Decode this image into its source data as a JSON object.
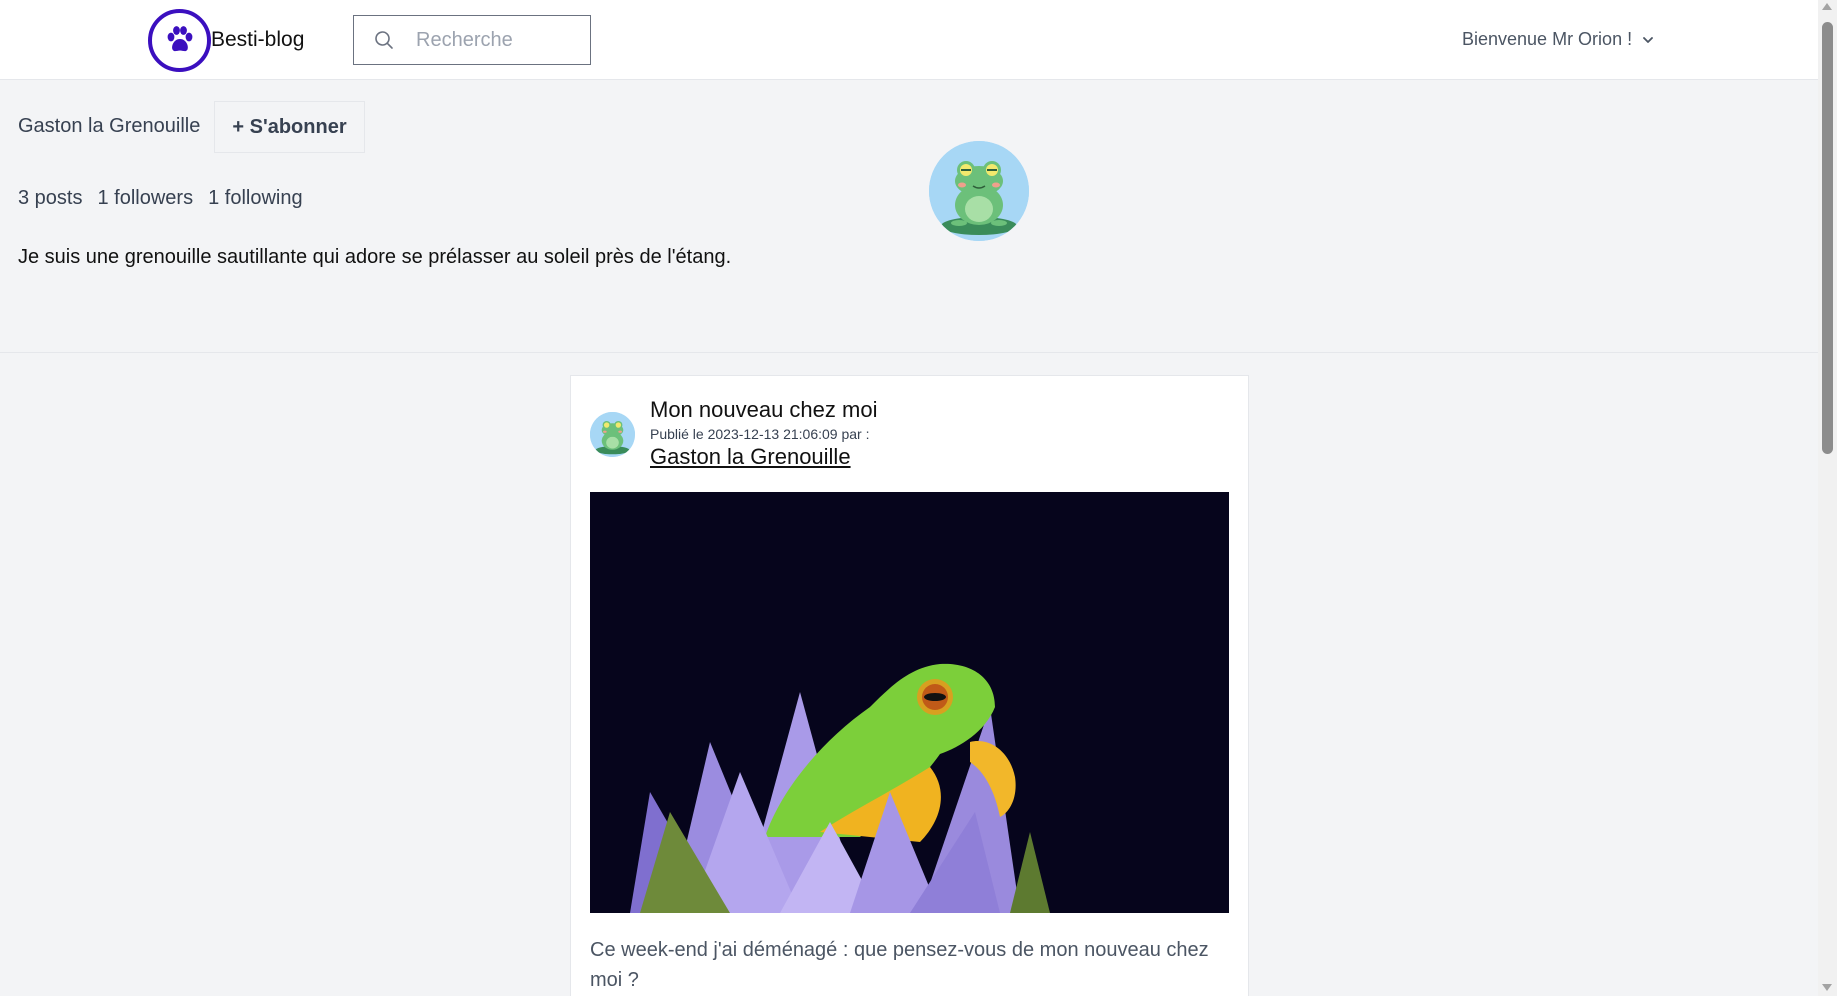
{
  "header": {
    "brand": "Besti-blog",
    "search_placeholder": "Recherche",
    "welcome": "Bienvenue Mr Orion !",
    "icons": {
      "logo": "paw-icon",
      "search": "search-icon",
      "dropdown": "chevron-down-icon"
    },
    "accent_color": "#3b0fbf"
  },
  "profile": {
    "name": "Gaston la Grenouille",
    "subscribe_label": "+ S'abonner",
    "stats": {
      "posts": "3 posts",
      "followers": "1 followers",
      "following": "1 following"
    },
    "bio": "Je suis une grenouille sautillante qui adore se prélasser au soleil près de l'étang."
  },
  "post": {
    "title": "Mon nouveau chez moi",
    "meta": "Publié le 2023-12-13 21:06:09 par :",
    "author": "Gaston la Grenouille",
    "body": "Ce week-end j'ai déménagé : que pensez-vous de mon nouveau chez moi ?"
  }
}
